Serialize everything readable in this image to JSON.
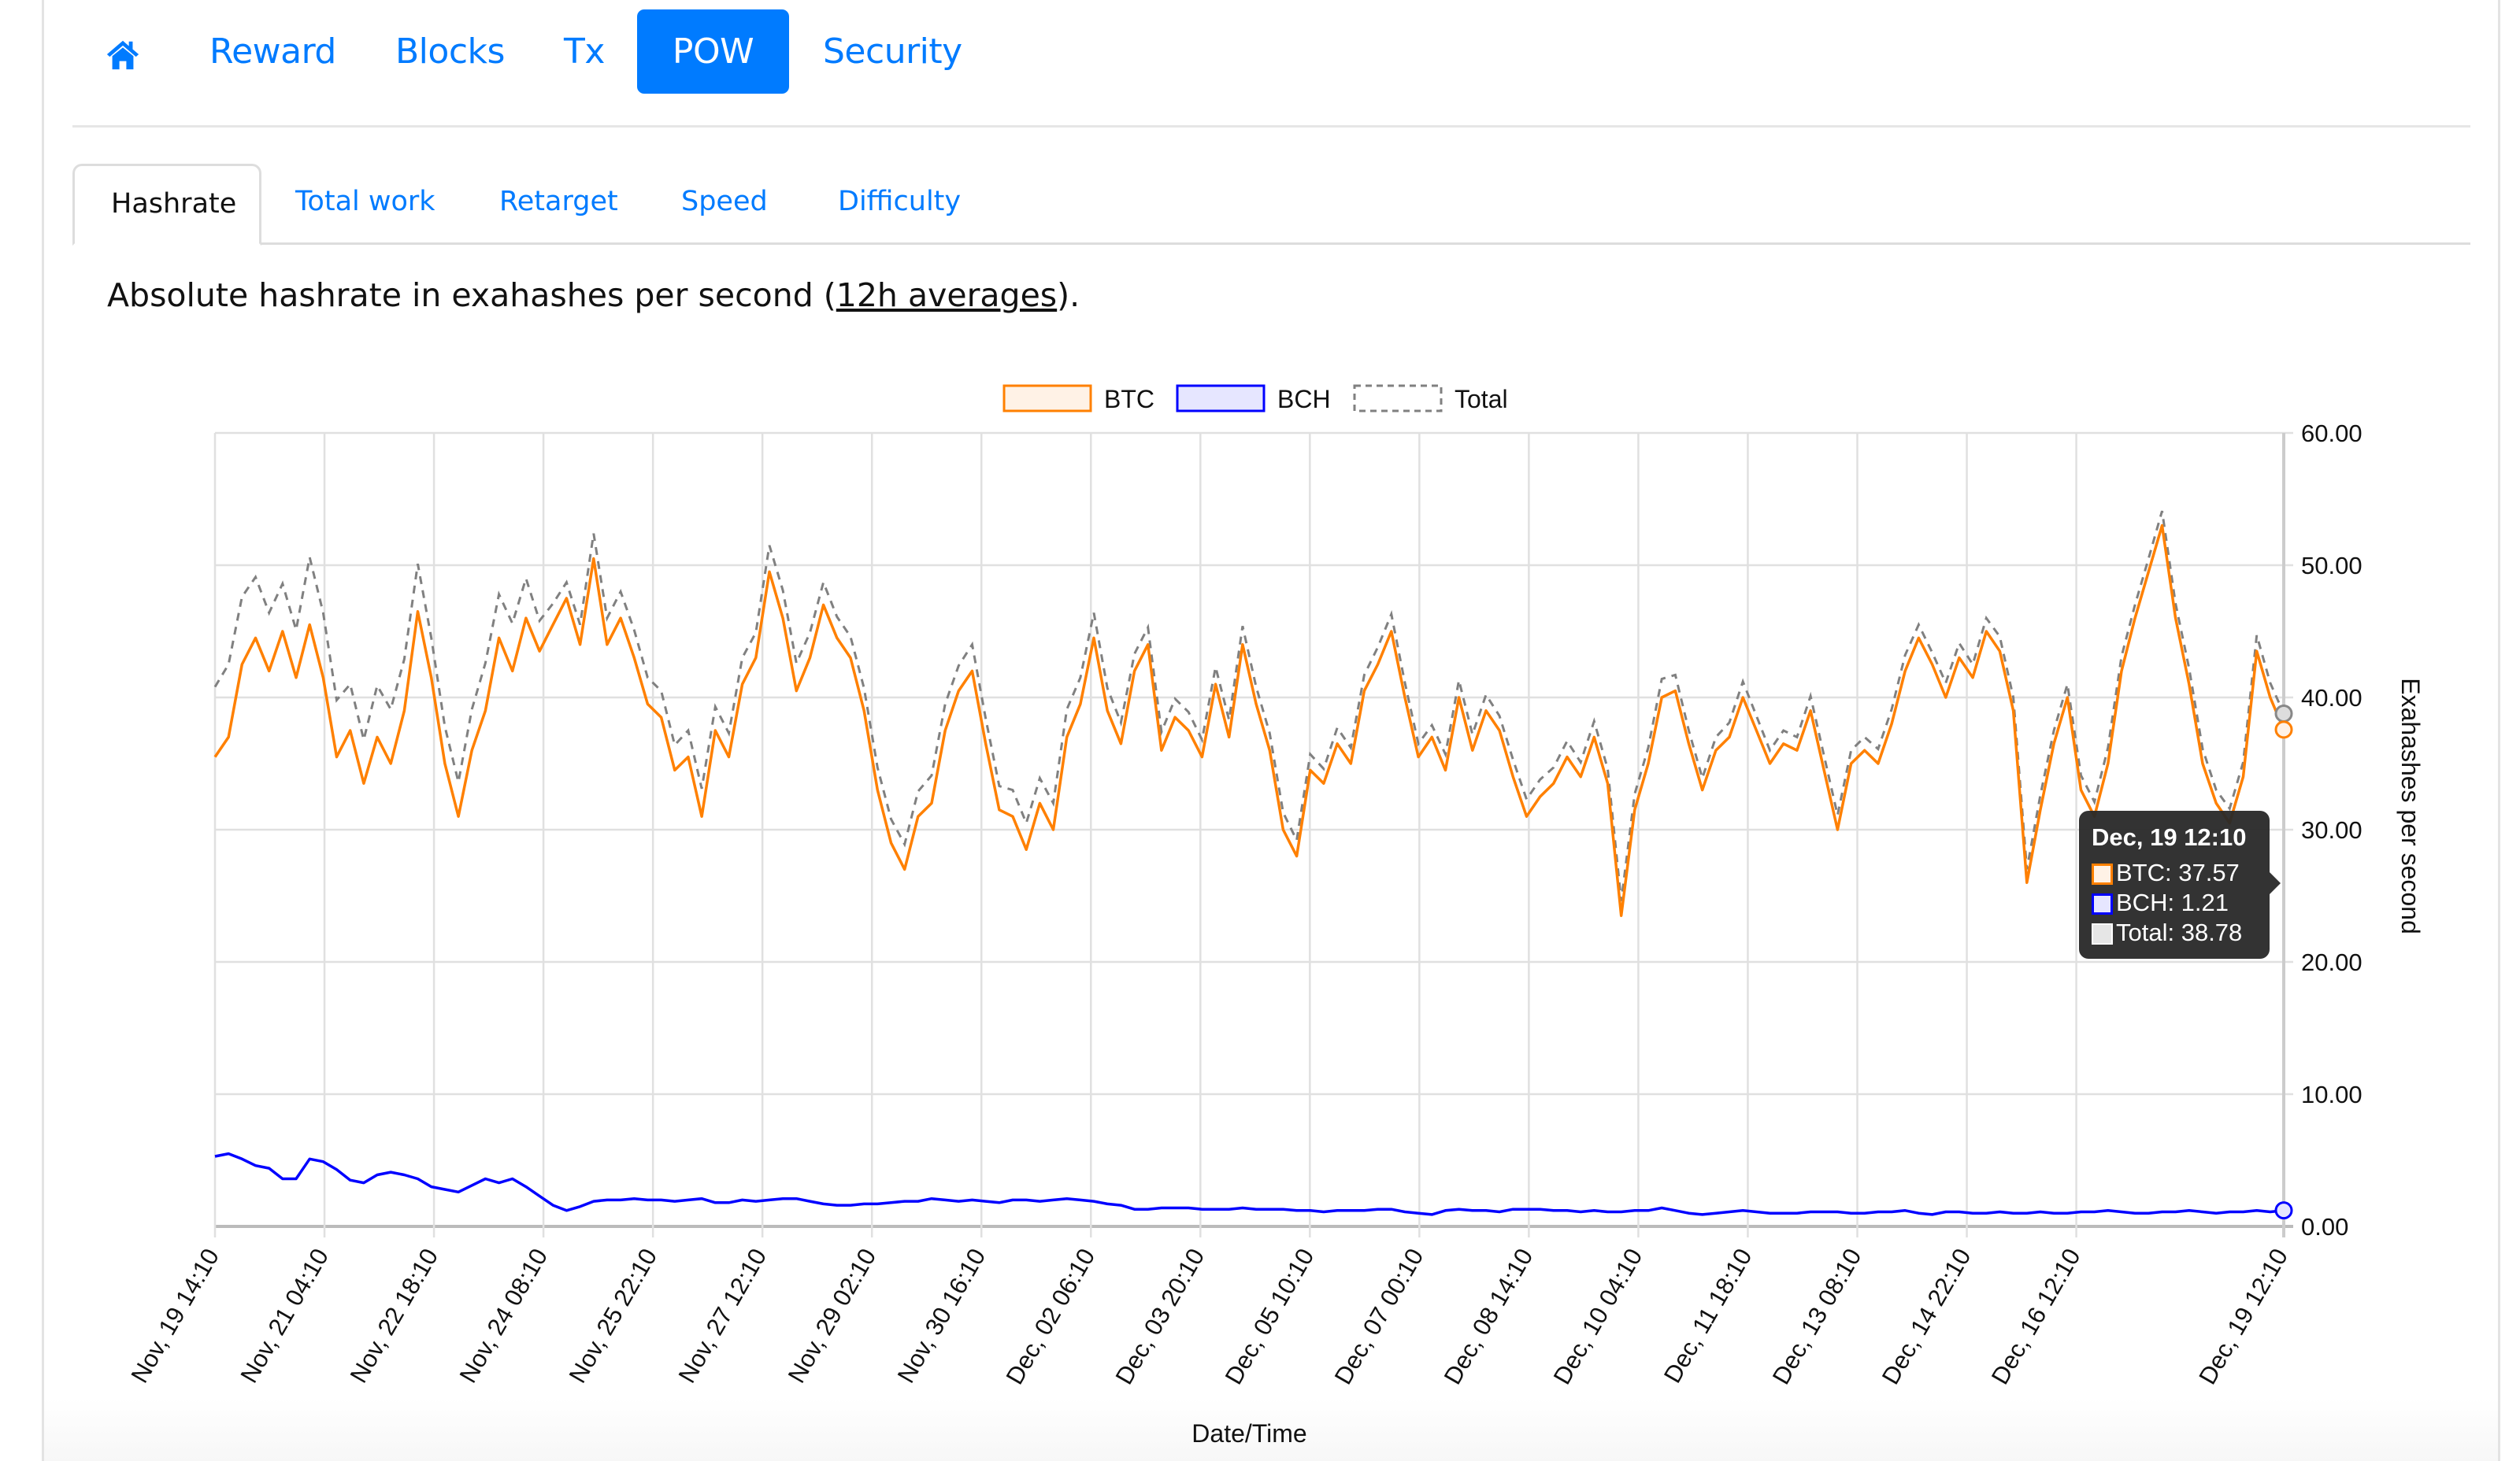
{
  "nav": {
    "home_icon": "home-icon",
    "items": [
      {
        "label": "Reward",
        "active": false
      },
      {
        "label": "Blocks",
        "active": false
      },
      {
        "label": "Tx",
        "active": false
      },
      {
        "label": "POW",
        "active": true
      },
      {
        "label": "Security",
        "active": false
      }
    ]
  },
  "tabs": [
    {
      "label": "Hashrate",
      "active": true
    },
    {
      "label": "Total work",
      "active": false
    },
    {
      "label": "Retarget",
      "active": false
    },
    {
      "label": "Speed",
      "active": false
    },
    {
      "label": "Difficulty",
      "active": false
    }
  ],
  "description": {
    "before": "Absolute hashrate in exahashes per second (",
    "link": "12h averages",
    "after": ")."
  },
  "colors": {
    "accent": "#007bff",
    "btc": "#ff8000",
    "btc_fill": "#fff2e6",
    "bch": "#0000ff",
    "bch_fill": "#e6e6ff",
    "total": "#808080",
    "grid": "#e0e0e0"
  },
  "tooltip": {
    "title": "Dec, 19 12:10",
    "rows": [
      {
        "label": "BTC: 37.57",
        "series": "btc"
      },
      {
        "label": "BCH: 1.21",
        "series": "bch"
      },
      {
        "label": "Total: 38.78",
        "series": "total"
      }
    ]
  },
  "chart_data": {
    "type": "line",
    "title": "",
    "xlabel": "Date/Time",
    "ylabel": "Exahashes per second",
    "ylim": [
      0,
      60
    ],
    "yticks": [
      "0.00",
      "10.00",
      "20.00",
      "30.00",
      "40.00",
      "50.00",
      "60.00"
    ],
    "grid": true,
    "legend": "top-center",
    "legend_entries": [
      "BTC",
      "BCH",
      "Total"
    ],
    "x_start": "Nov, 19 14:10",
    "x_end": "Dec, 19 12:10",
    "x_step_hours": 6,
    "xticks": [
      "Nov, 19 14:10",
      "Nov, 21 04:10",
      "Nov, 22 18:10",
      "Nov, 24 08:10",
      "Nov, 25 22:10",
      "Nov, 27 12:10",
      "Nov, 29 02:10",
      "Nov, 30 16:10",
      "Dec, 02 06:10",
      "Dec, 03 20:10",
      "Dec, 05 10:10",
      "Dec, 07 00:10",
      "Dec, 08 14:10",
      "Dec, 10 04:10",
      "Dec, 11 18:10",
      "Dec, 13 08:10",
      "Dec, 14 22:10",
      "Dec, 16 12:10",
      "Dec, 19 12:10"
    ],
    "xtick_hours": [
      0,
      38,
      76,
      114,
      152,
      190,
      228,
      266,
      304,
      342,
      380,
      418,
      456,
      494,
      532,
      570,
      608,
      646,
      718
    ],
    "series": [
      {
        "name": "BTC",
        "values": [
          35.5,
          37.0,
          42.5,
          44.5,
          42.0,
          45.0,
          41.5,
          45.5,
          41.5,
          35.5,
          37.5,
          33.5,
          37.0,
          35.0,
          39.0,
          46.5,
          41.5,
          35.0,
          31.0,
          36.0,
          39.0,
          44.5,
          42.0,
          46.0,
          43.5,
          45.5,
          47.5,
          44.0,
          50.5,
          44.0,
          46.0,
          43.0,
          39.5,
          38.5,
          34.5,
          35.5,
          31.0,
          37.5,
          35.5,
          41.0,
          43.0,
          49.5,
          46.0,
          40.5,
          43.0,
          47.0,
          44.5,
          43.0,
          39.0,
          33.0,
          29.0,
          27.0,
          31.0,
          32.0,
          37.5,
          40.5,
          42.0,
          36.5,
          31.5,
          31.0,
          28.5,
          32.0,
          30.0,
          37.0,
          39.5,
          44.5,
          39.0,
          36.5,
          42.0,
          44.0,
          36.0,
          38.5,
          37.5,
          35.5,
          41.0,
          37.0,
          44.0,
          39.5,
          36.0,
          30.0,
          28.0,
          34.5,
          33.5,
          36.5,
          35.0,
          40.5,
          42.5,
          45.0,
          40.0,
          35.5,
          37.0,
          34.5,
          40.0,
          36.0,
          39.0,
          37.5,
          34.0,
          31.0,
          32.5,
          33.5,
          35.5,
          34.0,
          37.0,
          33.5,
          23.5,
          31.5,
          35.0,
          40.0,
          40.5,
          36.5,
          33.0,
          36.0,
          37.0,
          40.0,
          37.5,
          35.0,
          36.5,
          36.0,
          39.0,
          34.5,
          30.0,
          35.0,
          36.0,
          35.0,
          38.0,
          42.0,
          44.5,
          42.5,
          40.0,
          43.0,
          41.5,
          45.0,
          43.5,
          39.0,
          26.0,
          31.5,
          36.5,
          40.0,
          33.0,
          31.0,
          35.0,
          42.0,
          46.0,
          49.5,
          53.0,
          46.0,
          41.0,
          35.0,
          32.0,
          30.5,
          34.0,
          43.5,
          40.0,
          37.57
        ]
      },
      {
        "name": "BCH",
        "values": [
          5.3,
          5.5,
          5.1,
          4.6,
          4.4,
          3.6,
          3.6,
          5.1,
          4.9,
          4.3,
          3.5,
          3.3,
          3.9,
          4.1,
          3.9,
          3.6,
          3.0,
          2.8,
          2.6,
          3.1,
          3.6,
          3.3,
          3.6,
          3.0,
          2.3,
          1.6,
          1.2,
          1.5,
          1.9,
          2.0,
          2.0,
          2.1,
          2.0,
          2.0,
          1.9,
          2.0,
          2.1,
          1.8,
          1.8,
          2.0,
          1.9,
          2.0,
          2.1,
          2.1,
          1.9,
          1.7,
          1.6,
          1.6,
          1.7,
          1.7,
          1.8,
          1.9,
          1.9,
          2.1,
          2.0,
          1.9,
          2.0,
          1.9,
          1.8,
          2.0,
          2.0,
          1.9,
          2.0,
          2.1,
          2.0,
          1.9,
          1.7,
          1.6,
          1.3,
          1.3,
          1.4,
          1.4,
          1.4,
          1.3,
          1.3,
          1.3,
          1.4,
          1.3,
          1.3,
          1.3,
          1.2,
          1.2,
          1.1,
          1.2,
          1.2,
          1.2,
          1.3,
          1.3,
          1.1,
          1.0,
          0.9,
          1.2,
          1.3,
          1.2,
          1.2,
          1.1,
          1.3,
          1.3,
          1.3,
          1.2,
          1.2,
          1.1,
          1.2,
          1.1,
          1.1,
          1.2,
          1.2,
          1.4,
          1.2,
          1.0,
          0.9,
          1.0,
          1.1,
          1.2,
          1.1,
          1.0,
          1.0,
          1.0,
          1.1,
          1.1,
          1.1,
          1.0,
          1.0,
          1.1,
          1.1,
          1.2,
          1.0,
          0.9,
          1.1,
          1.1,
          1.0,
          1.0,
          1.1,
          1.0,
          1.0,
          1.1,
          1.0,
          1.0,
          1.1,
          1.1,
          1.2,
          1.1,
          1.0,
          1.0,
          1.1,
          1.1,
          1.2,
          1.1,
          1.0,
          1.1,
          1.1,
          1.2,
          1.1,
          1.21
        ]
      },
      {
        "name": "Total",
        "values": "BTC + BCH (per point)",
        "last_value": 38.78
      }
    ]
  }
}
